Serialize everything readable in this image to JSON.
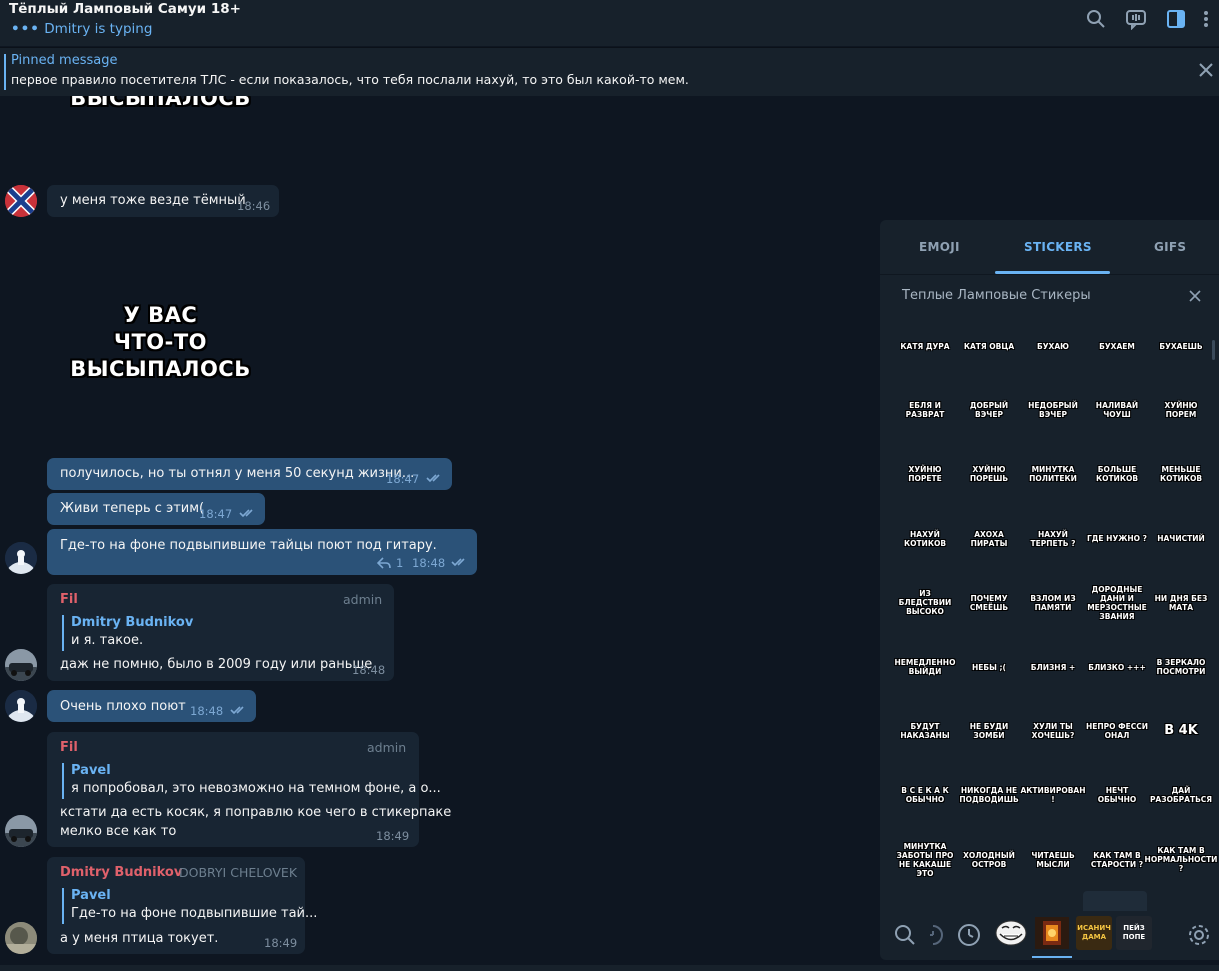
{
  "header": {
    "title": "Тёплый Ламповый Самуи 18+",
    "status": "Dmitry is typing",
    "icons": [
      "search-icon",
      "chat-icon",
      "sidebar-icon",
      "more-icon"
    ]
  },
  "pinned": {
    "label": "Pinned message",
    "text": "первое правило посетителя ТЛС - если показалось, что тебя послали нахуй, то это был какой-то мем."
  },
  "stickers_in_chat": {
    "top_partial": "ВЫСЫПАЛОСЬ",
    "main": [
      "У ВАС",
      "ЧТО-ТО",
      "ВЫСЫПАЛОСЬ"
    ]
  },
  "messages": {
    "m1": {
      "text": "у меня тоже везде тёмный",
      "time": "18:46"
    },
    "m2": {
      "text": "получилось, но ты отнял у меня 50 секунд жизни...",
      "time": "18:47"
    },
    "m3": {
      "text": "Живи теперь с этим(",
      "time": "18:47"
    },
    "m4": {
      "text": "Где-то на фоне подвыпившие тайцы поют под гитару.",
      "replies": "1",
      "time": "18:48"
    },
    "m5": {
      "sender": "Fil",
      "role": "admin",
      "quote_name": "Dmitry Budnikov",
      "quote_text": "и я. такое.",
      "text": "даж не помню, было в 2009 году или раньше",
      "time": "18:48"
    },
    "m6": {
      "text": "Очень плохо поют",
      "time": "18:48"
    },
    "m7": {
      "sender": "Fil",
      "role": "admin",
      "quote_name": "Pavel",
      "quote_text": "я попробовал, это невозможно на темном фоне, а о...",
      "text1": "кстати да есть косяк, я поправлю кое чего в стикерпаке",
      "text2": "мелко все как то",
      "time": "18:49"
    },
    "m8": {
      "sender": "Dmitry Budnikov",
      "role": "DOBRYI CHELOVEK",
      "quote_name": "Pavel",
      "quote_text": "Где-то на фоне подвыпившие тай...",
      "text": "а у меня птица токует.",
      "time": "18:49"
    }
  },
  "panel": {
    "tabs": [
      "EMOJI",
      "STICKERS",
      "GIFS"
    ],
    "active_tab": "STICKERS",
    "pack_title": "Теплые Ламповые Стикеры",
    "stickers": [
      "КАТЯ ДУРА",
      "КАТЯ ОВЦА",
      "БУХАЮ",
      "БУХАЕМ",
      "БУХАЕШЬ",
      "ЕБЛЯ И РАЗВРАТ",
      "ДОБРЫЙ ВЭЧЕР",
      "НЕДОБРЫЙ ВЭЧЕР",
      "НАЛИВАЙ ЧОУШ",
      "ХУЙНЮ ПОРЕМ",
      "ХУЙНЮ ПОРЕТЕ",
      "ХУЙНЮ ПОРЕШЬ",
      "МИНУТКА ПОЛИТЕКИ",
      "БОЛЬШЕ КОТИКОВ",
      "МЕНЬШЕ КОТИКОВ",
      "НАХУЙ КОТИКОВ",
      "АХОХА ПИРАТЫ",
      "НАХУЙ ТЕРПЕТЬ ?",
      "ГДЕ НУЖНО ?",
      "НАЧИСТИЙ",
      "ИЗ БЛЕДСТВИИ ВЫСОКО",
      "ПОЧЕМУ СМЕЁШЬ",
      "ВЗЛОМ ИЗ ПАМЯТИ",
      "ДОРОДНЫЕ ДАНИ И МЕРЗОСТНЫЕ ЗВАНИЯ",
      "НИ ДНЯ БЕЗ МАТА",
      "НЕМЕДЛЕННО ВЫЙДИ",
      "НЕБЫ ;(",
      "БЛИЗНЯ +",
      "БЛИЗКО +++",
      "В ЗЕРКАЛО ПОСМОТРИ",
      "БУДУТ НАКАЗАНЫ",
      "НЕ БУДИ ЗОМБИ",
      "ХУЛИ ТЫ ХОЧЕШЬ?",
      "НЕПРО ФЕССИ ОНАЛ",
      "В 4K",
      "В С Е К А К ОБЫЧНО",
      "НИКОГДА НЕ ПОДВОДИШЬ",
      "АКТИВИРОВАН !",
      "НЕЧТ ОБЫЧНО",
      "ДАЙ РАЗОБРАТЬСЯ",
      "МИНУТКА ЗАБОТЫ ПРО НЕ КАКАШЕ ЭТО",
      "ХОЛОДНЫЙ ОСТРОВ",
      "ЧИТАЕШЬ МЫСЛИ",
      "КАК ТАМ В СТАРОСТИ ?",
      "КАК ТАМ В НОРМАЛЬНОСТИ ?"
    ],
    "bottom_icons": [
      "search-icon",
      "gif-recent-icon",
      "clock-icon",
      "trollface-sticker",
      "lamp-sticker",
      "dama-sticker",
      "pack-sticker",
      "settings-icon"
    ],
    "thumb_labels": {
      "dama": "ИСАНИЧ ДАМА",
      "pack": "ПЕЙЗ ПОПЕ"
    }
  },
  "colors": {
    "bg": "#0e1621",
    "panel": "#17212b",
    "accent": "#6ab3f3",
    "out_bubble": "#2b5278",
    "in_bubble": "#182533",
    "sender_red": "#e0616b"
  }
}
